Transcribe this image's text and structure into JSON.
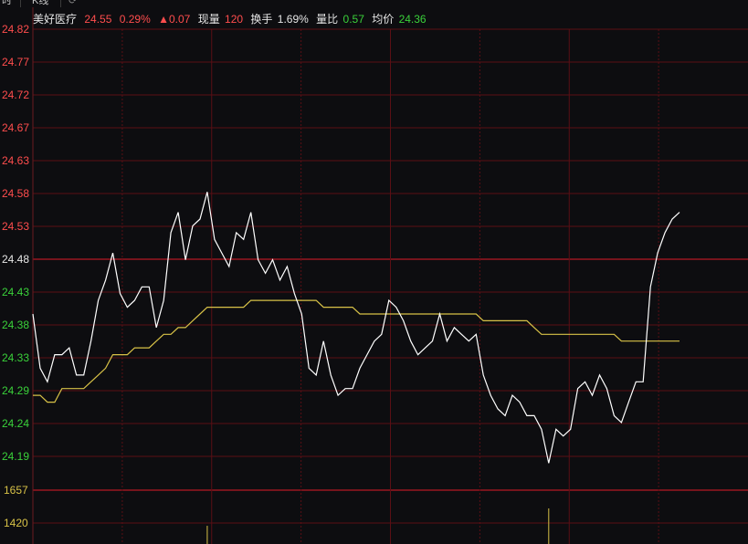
{
  "tabs": {
    "left_label": "时",
    "kline_label": "K线"
  },
  "header": {
    "name": "美好医疗",
    "price": "24.55",
    "change_pct": "0.29%",
    "change_amt": "▲0.07",
    "volume_label": "现量",
    "volume_value": "120",
    "turnover_label": "换手",
    "turnover_value": "1.69%",
    "ratio_label": "量比",
    "ratio_value": "0.57",
    "avg_label": "均价",
    "avg_value": "24.36"
  },
  "colors": {
    "background": "#0d0d10",
    "grid": "#5a0f14",
    "price_line": "#ffffff",
    "avg_line": "#d8c247",
    "up": "#ff4d4d",
    "down": "#3ad13a",
    "volume_axis": "#d8c247"
  },
  "chart_data": {
    "type": "line",
    "title": "",
    "xlabel": "",
    "ylabel": "",
    "ylim": [
      24.19,
      24.82
    ],
    "y_ticks": [
      "24.82",
      "24.77",
      "24.72",
      "24.67",
      "24.63",
      "24.58",
      "24.53",
      "24.48",
      "24.43",
      "24.38",
      "24.33",
      "24.29",
      "24.24",
      "24.19"
    ],
    "reference_price": 24.48,
    "series": [
      {
        "role": "price",
        "values": [
          24.4,
          24.32,
          24.3,
          24.34,
          24.34,
          24.35,
          24.31,
          24.31,
          24.36,
          24.42,
          24.45,
          24.49,
          24.43,
          24.41,
          24.42,
          24.44,
          24.44,
          24.38,
          24.42,
          24.52,
          24.55,
          24.48,
          24.53,
          24.54,
          24.58,
          24.51,
          24.49,
          24.47,
          24.52,
          24.51,
          24.55,
          24.48,
          24.46,
          24.48,
          24.45,
          24.47,
          24.43,
          24.4,
          24.32,
          24.31,
          24.36,
          24.31,
          24.28,
          24.29,
          24.29,
          24.32,
          24.34,
          24.36,
          24.37,
          24.42,
          24.41,
          24.39,
          24.36,
          24.34,
          24.35,
          24.36,
          24.4,
          24.36,
          24.38,
          24.37,
          24.36,
          24.37,
          24.31,
          24.28,
          24.26,
          24.25,
          24.28,
          24.27,
          24.25,
          24.25,
          24.23,
          24.18,
          24.23,
          24.22,
          24.23,
          24.29,
          24.3,
          24.28,
          24.31,
          24.29,
          24.25,
          24.24,
          24.27,
          24.3,
          24.3,
          24.44,
          24.49,
          24.52,
          24.54,
          24.55
        ]
      },
      {
        "role": "average",
        "values": [
          24.28,
          24.28,
          24.27,
          24.27,
          24.29,
          24.29,
          24.29,
          24.29,
          24.3,
          24.31,
          24.32,
          24.34,
          24.34,
          24.34,
          24.35,
          24.35,
          24.35,
          24.36,
          24.37,
          24.37,
          24.38,
          24.38,
          24.39,
          24.4,
          24.41,
          24.41,
          24.41,
          24.41,
          24.41,
          24.41,
          24.42,
          24.42,
          24.42,
          24.42,
          24.42,
          24.42,
          24.42,
          24.42,
          24.42,
          24.42,
          24.41,
          24.41,
          24.41,
          24.41,
          24.41,
          24.4,
          24.4,
          24.4,
          24.4,
          24.4,
          24.4,
          24.4,
          24.4,
          24.4,
          24.4,
          24.4,
          24.4,
          24.4,
          24.4,
          24.4,
          24.4,
          24.4,
          24.39,
          24.39,
          24.39,
          24.39,
          24.39,
          24.39,
          24.39,
          24.38,
          24.37,
          24.37,
          24.37,
          24.37,
          24.37,
          24.37,
          24.37,
          24.37,
          24.37,
          24.37,
          24.37,
          24.36,
          24.36,
          24.36,
          24.36,
          24.36,
          24.36,
          24.36,
          24.36,
          24.36
        ]
      }
    ],
    "volume": {
      "y_ticks": [
        "1657",
        "1420"
      ],
      "ylim": [
        1420,
        1657
      ],
      "bars": [
        {
          "index": 24,
          "value": 1400
        },
        {
          "index": 71,
          "value": 1680
        }
      ]
    }
  }
}
